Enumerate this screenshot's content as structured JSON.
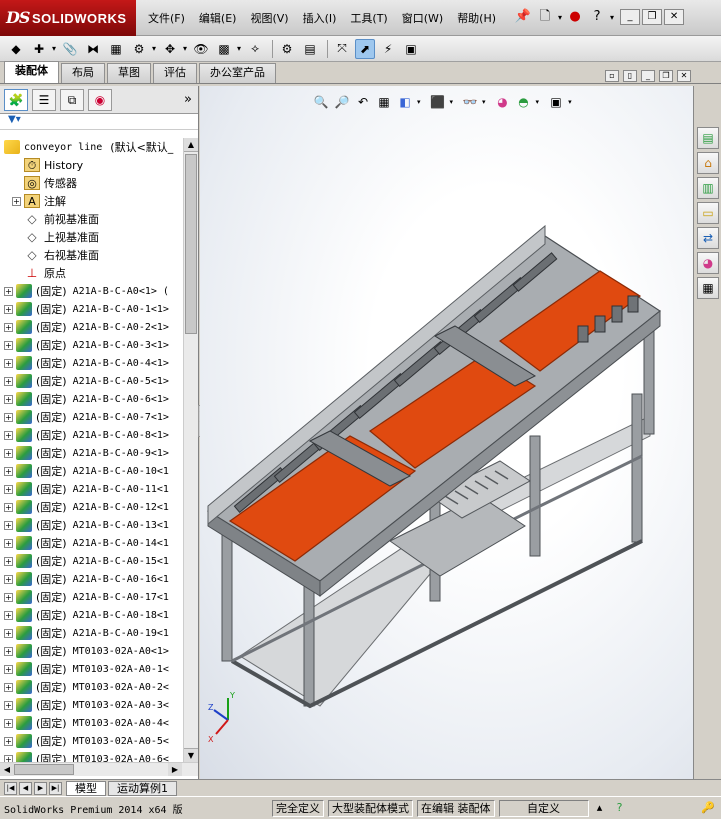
{
  "app": {
    "logo_prefix": "DS",
    "logo_text": "SOLIDWORKS"
  },
  "menu": [
    "文件(F)",
    "编辑(E)",
    "视图(V)",
    "插入(I)",
    "工具(T)",
    "窗口(W)",
    "帮助(H)"
  ],
  "title_icons": [
    "pin-icon",
    "new-document-icon",
    "traffic-light-icon",
    "help-icon",
    "minimize-icon",
    "restore-icon",
    "close-icon"
  ],
  "toolbar_icons": [
    "part-icon",
    "assembly-insert-icon",
    "paperclip-icon",
    "mate-icon",
    "linear-pattern-icon",
    "smart-fasteners-icon",
    "move-component-icon",
    "show-hidden-icon",
    "assembly-features-icon",
    "reference-geometry-icon",
    "new-motion-study-icon",
    "bill-of-materials-icon",
    "exploded-view-icon",
    "instant3d-icon",
    "assembly-xpert-icon",
    "sheet-icon"
  ],
  "cm_tabs": [
    "装配体",
    "布局",
    "草图",
    "评估",
    "办公室产品"
  ],
  "active_cm_tab": 0,
  "lp_tabs": [
    "feature-manager-icon",
    "property-manager-icon",
    "configuration-manager-icon",
    "display-manager-icon"
  ],
  "tree": {
    "root": {
      "name": "conveyor line",
      "config": "(默认<默认_"
    },
    "items": [
      {
        "label": "History",
        "icon": "history-icon",
        "exp": false
      },
      {
        "label": "传感器",
        "icon": "sensor-icon",
        "exp": false
      },
      {
        "label": "注解",
        "icon": "annotation-icon",
        "exp": true
      },
      {
        "label": "前视基准面",
        "icon": "plane-icon",
        "exp": false
      },
      {
        "label": "上视基准面",
        "icon": "plane-icon",
        "exp": false
      },
      {
        "label": "右视基准面",
        "icon": "plane-icon",
        "exp": false
      },
      {
        "label": "原点",
        "icon": "origin-icon",
        "exp": false
      }
    ],
    "components": [
      {
        "state": "(固定)",
        "name": "A21A-B-C-A0<1> ("
      },
      {
        "state": "(固定)",
        "name": "A21A-B-C-A0-1<1>"
      },
      {
        "state": "(固定)",
        "name": "A21A-B-C-A0-2<1>"
      },
      {
        "state": "(固定)",
        "name": "A21A-B-C-A0-3<1>"
      },
      {
        "state": "(固定)",
        "name": "A21A-B-C-A0-4<1>"
      },
      {
        "state": "(固定)",
        "name": "A21A-B-C-A0-5<1>"
      },
      {
        "state": "(固定)",
        "name": "A21A-B-C-A0-6<1>"
      },
      {
        "state": "(固定)",
        "name": "A21A-B-C-A0-7<1>"
      },
      {
        "state": "(固定)",
        "name": "A21A-B-C-A0-8<1>"
      },
      {
        "state": "(固定)",
        "name": "A21A-B-C-A0-9<1>"
      },
      {
        "state": "(固定)",
        "name": "A21A-B-C-A0-10<1"
      },
      {
        "state": "(固定)",
        "name": "A21A-B-C-A0-11<1"
      },
      {
        "state": "(固定)",
        "name": "A21A-B-C-A0-12<1"
      },
      {
        "state": "(固定)",
        "name": "A21A-B-C-A0-13<1"
      },
      {
        "state": "(固定)",
        "name": "A21A-B-C-A0-14<1"
      },
      {
        "state": "(固定)",
        "name": "A21A-B-C-A0-15<1"
      },
      {
        "state": "(固定)",
        "name": "A21A-B-C-A0-16<1"
      },
      {
        "state": "(固定)",
        "name": "A21A-B-C-A0-17<1"
      },
      {
        "state": "(固定)",
        "name": "A21A-B-C-A0-18<1"
      },
      {
        "state": "(固定)",
        "name": "A21A-B-C-A0-19<1"
      },
      {
        "state": "(固定)",
        "name": "MT0103-02A-A0<1>"
      },
      {
        "state": "(固定)",
        "name": "MT0103-02A-A0-1<"
      },
      {
        "state": "(固定)",
        "name": "MT0103-02A-A0-2<"
      },
      {
        "state": "(固定)",
        "name": "MT0103-02A-A0-3<"
      },
      {
        "state": "(固定)",
        "name": "MT0103-02A-A0-4<"
      },
      {
        "state": "(固定)",
        "name": "MT0103-02A-A0-5<"
      },
      {
        "state": "(固定)",
        "name": "MT0103-02A-A0-6<"
      }
    ]
  },
  "model_tabs": [
    "模型",
    "运动算例1"
  ],
  "active_model_tab": 0,
  "status": {
    "app_version": "SolidWorks Premium 2014 x64 版",
    "fields": [
      "完全定义",
      "大型装配体模式",
      "在编辑 装配体",
      "自定义"
    ]
  },
  "headsup_icons": [
    "zoom-to-fit-icon",
    "zoom-area-icon",
    "previous-view-icon",
    "section-view-icon",
    "view-orientation-icon",
    "display-style-icon",
    "hide-show-items-icon",
    "edit-appearance-icon",
    "apply-scene-icon",
    "view-settings-icon"
  ],
  "task_pane_icons": [
    "solidworks-resources-icon",
    "design-library-icon",
    "file-explorer-icon",
    "open-folder-icon",
    "view-palette-icon",
    "appearances-icon",
    "custom-properties-icon"
  ],
  "colors": {
    "belt": "#e04a10",
    "frame": "#8f9396",
    "logo_red": "#b01010",
    "accent": "#9ec7ee"
  },
  "triad": {
    "x": "X",
    "y": "Y",
    "z": "Z"
  }
}
